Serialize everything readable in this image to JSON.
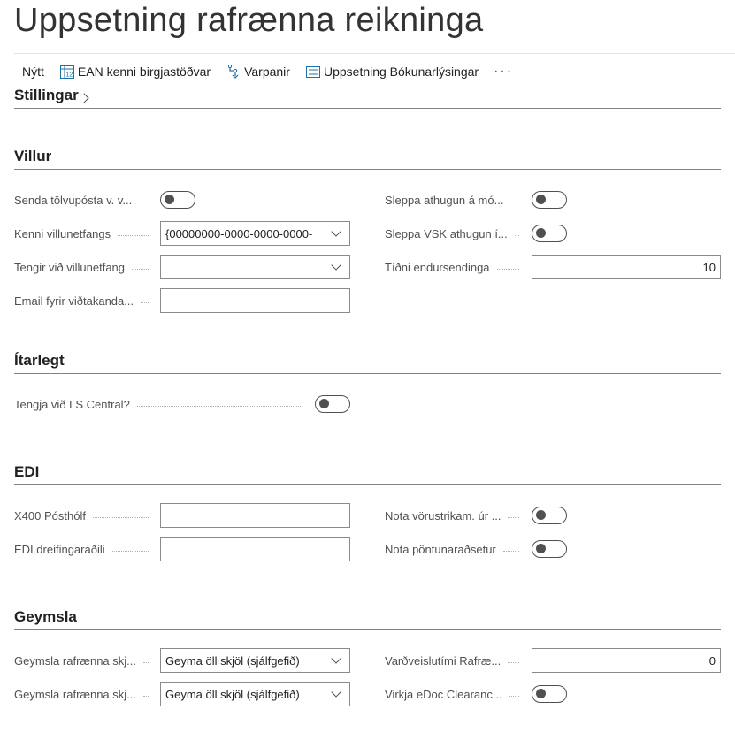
{
  "page": {
    "title": "Uppsetning rafrænna reikninga"
  },
  "actions": {
    "new": "Nýtt",
    "ean": "EAN kenni birgjastöðvar",
    "fallbacks": "Varpanir",
    "posting": "Uppsetning Bókunarlýsingar",
    "more": "···"
  },
  "sections": {
    "settings": "Stillingar",
    "errors": "Villur",
    "advanced": "Ítarlegt",
    "edi": "EDI",
    "storage": "Geymsla"
  },
  "errors": {
    "send_email_label": "Senda tölvupósta v. v...",
    "send_email_value": false,
    "skip_check_label": "Sleppa athugun á mó...",
    "skip_check_value": false,
    "error_email_id_label": "Kenni villunetfangs",
    "error_email_id_value": "{00000000-0000-0000-0000-",
    "skip_vat_label": "Sleppa VSK athugun í...",
    "skip_vat_value": false,
    "linked_email_label": "Tengir við villunetfang",
    "linked_email_value": "",
    "resend_freq_label": "Tíðni endursendinga",
    "resend_freq_value": "10",
    "recipient_email_label": "Email fyrir viðtakanda...",
    "recipient_email_value": ""
  },
  "advanced": {
    "ls_central_label": "Tengja við LS Central?",
    "ls_central_value": false
  },
  "edi": {
    "x400_label": "X400 Pósthólf",
    "x400_value": "",
    "use_barcode_label": "Nota vörustrikam. úr ...",
    "use_barcode_value": false,
    "distributor_label": "EDI dreifingaraðili",
    "distributor_value": "",
    "use_order_label": "Nota pöntunaraðsetur",
    "use_order_value": false
  },
  "storage": {
    "storage1_label": "Geymsla rafrænna skj...",
    "storage1_value": "Geyma öll skjöl (sjálfgefið)",
    "retention_label": "Varðveislutími Rafræ...",
    "retention_value": "0",
    "storage2_label": "Geymsla rafrænna skj...",
    "storage2_value": "Geyma öll skjöl (sjálfgefið)",
    "edoc_label": "Virkja eDoc Clearanc...",
    "edoc_value": false
  }
}
